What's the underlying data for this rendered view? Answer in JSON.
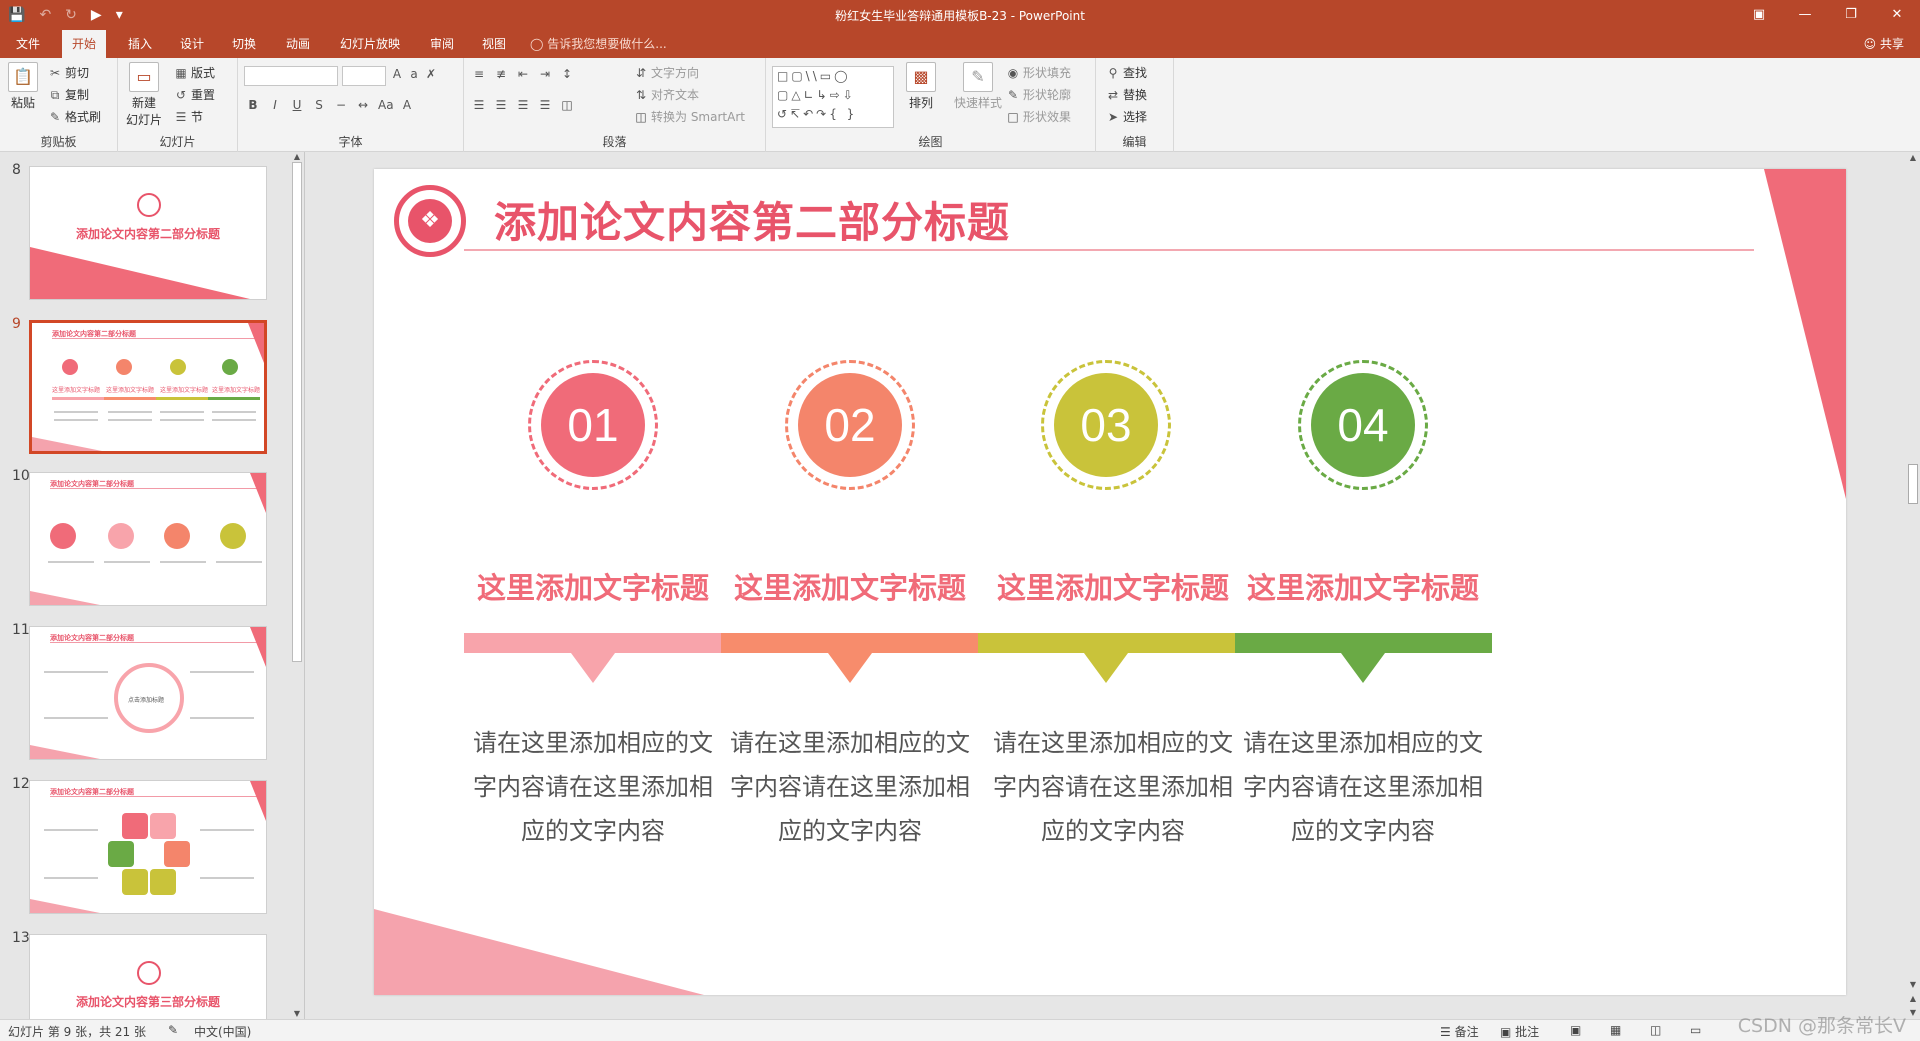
{
  "titlebar": {
    "doc_title": "粉红女生毕业答辩通用模板B-23 - PowerPoint",
    "qat": [
      "save-icon",
      "undo-icon",
      "redo-icon",
      "start-from-beginning-icon",
      "customize-icon"
    ]
  },
  "tabs": {
    "file": "文件",
    "home": "开始",
    "insert": "插入",
    "design": "设计",
    "transitions": "切换",
    "animations": "动画",
    "slideshow": "幻灯片放映",
    "review": "审阅",
    "view": "视图",
    "tellme": "告诉我您想要做什么...",
    "share": "共享"
  },
  "ribbon": {
    "clipboard": {
      "paste": "粘贴",
      "cut": "剪切",
      "copy": "复制",
      "format_painter": "格式刷",
      "name": "剪贴板"
    },
    "slides": {
      "new_slide_1": "新建",
      "new_slide_2": "幻灯片",
      "layout": "版式",
      "reset": "重置",
      "section": "节",
      "name": "幻灯片"
    },
    "font": {
      "name": "字体"
    },
    "paragraph": {
      "text_direction": "文字方向",
      "align_text": "对齐文本",
      "smartart": "转换为 SmartArt",
      "name": "段落"
    },
    "drawing": {
      "arrange": "排列",
      "quick_styles": "快速样式",
      "shape_fill": "形状填充",
      "shape_outline": "形状轮廓",
      "shape_effects": "形状效果",
      "name": "绘图"
    },
    "editing": {
      "find": "查找",
      "replace": "替换",
      "select": "选择",
      "name": "编辑"
    }
  },
  "thumbnails": {
    "numbers": [
      "8",
      "9",
      "10",
      "11",
      "12",
      "13"
    ],
    "slide8_title": "添加论文内容第二部分标题",
    "slide13_title": "添加论文内容第三部分标题",
    "header": "添加论文内容第二部分标题",
    "mini_labels": [
      "这里添加文字标题",
      "这里添加文字标题",
      "这里添加文字标题",
      "这里添加文字标题"
    ],
    "nums": [
      "01",
      "02",
      "03",
      "04"
    ],
    "slide11_center": "点击添加标题"
  },
  "slide": {
    "title": "添加论文内容第二部分标题",
    "items": [
      {
        "num": "01",
        "title": "这里添加文字标题",
        "line1": "请在这里添加相应的文",
        "line2": "字内容请在这里添加相",
        "line3": "应的文字内容"
      },
      {
        "num": "02",
        "title": "这里添加文字标题",
        "line1": "请在这里添加相应的文",
        "line2": "字内容请在这里添加相",
        "line3": "应的文字内容"
      },
      {
        "num": "03",
        "title": "这里添加文字标题",
        "line1": "请在这里添加相应的文",
        "line2": "字内容请在这里添加相",
        "line3": "应的文字内容"
      },
      {
        "num": "04",
        "title": "这里添加文字标题",
        "line1": "请在这里添加相应的文",
        "line2": "字内容请在这里添加相",
        "line3": "应的文字内容"
      }
    ]
  },
  "colors": {
    "accent": "#b7472a",
    "pink": "#f06b79",
    "salmon": "#f4856b",
    "olive": "#c9c33a",
    "green": "#6aaa45",
    "bar1": "#f8a4ab",
    "bar2": "#f78c6c",
    "bar3": "#c9c33a",
    "bar4": "#6aaa45"
  },
  "status": {
    "slide_info": "幻灯片 第 9 张，共 21 张",
    "language": "中文(中国)",
    "notes": "备注",
    "comments": "批注"
  },
  "watermark": "CSDN @那条常长V"
}
